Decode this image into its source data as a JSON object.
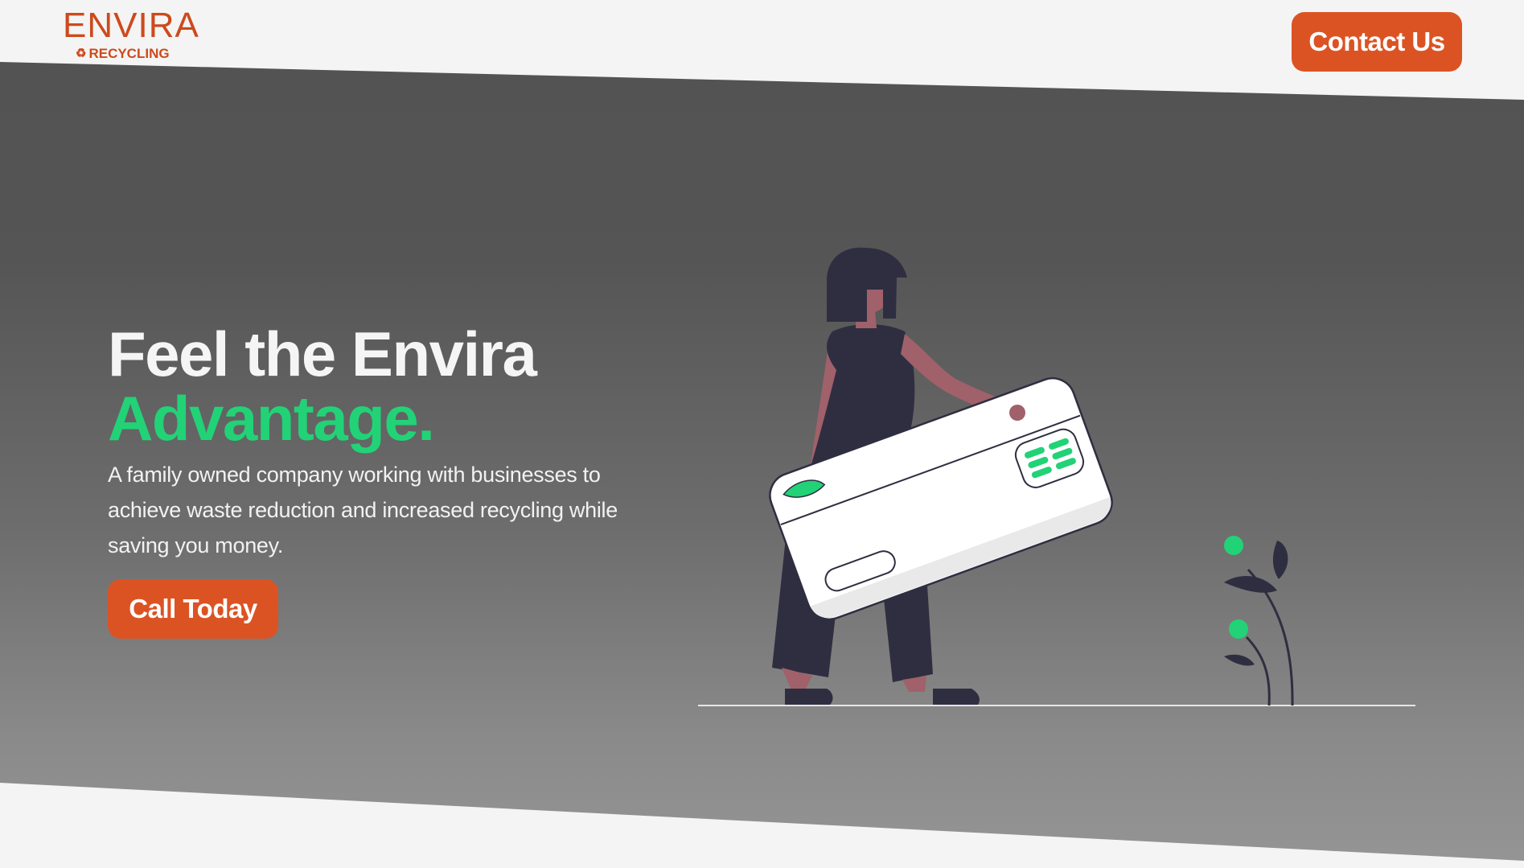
{
  "header": {
    "logo_top": "ENVIRA",
    "logo_bottom": "RECYCLING",
    "logo_icon": "recycle-icon",
    "contact_label": "Contact Us"
  },
  "hero": {
    "headline_line1": "Feel the Envira",
    "headline_line2": "Advantage.",
    "subtext": "A family owned company working with businesses to achieve waste reduction and increased recycling while saving you money.",
    "cta_label": "Call Today"
  },
  "colors": {
    "brand_orange": "#dc5323",
    "logo_orange": "#cc4a1c",
    "accent_green": "#22d277",
    "hero_gray_top": "#525252",
    "hero_gray_bottom": "#959595",
    "page_background": "#f4f4f4",
    "figure_dark": "#2f2e41",
    "figure_skin": "#a0616a"
  },
  "illustration": {
    "subject": "woman-holding-credit-card",
    "plant": "plant-with-green-buds"
  }
}
